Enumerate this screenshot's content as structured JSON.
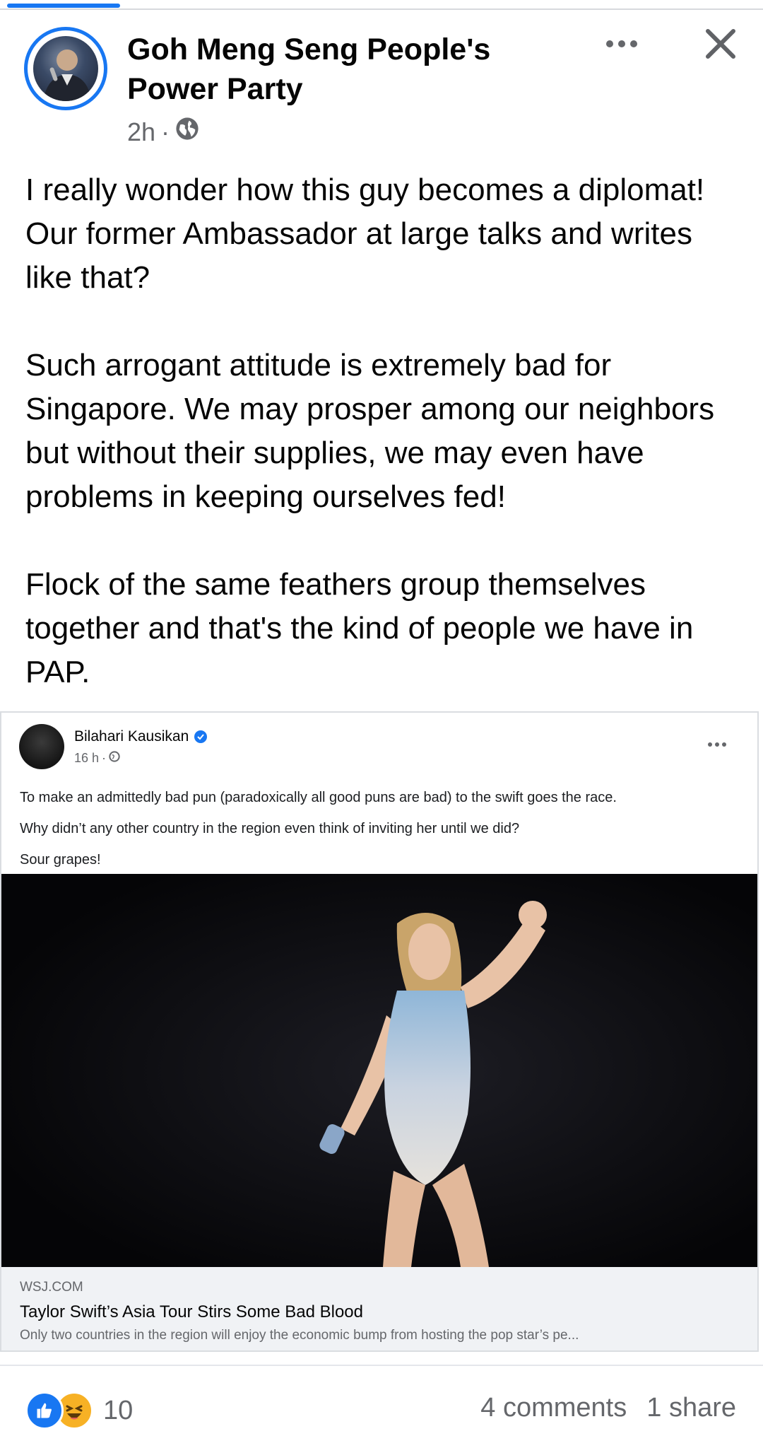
{
  "post": {
    "page_name": "Goh Meng Seng People's Power Party",
    "time": "2h",
    "separator": "·",
    "paragraphs": [
      "I really wonder how this guy becomes a diplomat! Our former Ambassador at large talks and writes like that?",
      "Such arrogant attitude is extremely bad for Singapore. We may prosper among our neighbors but without their supplies, we may even have problems in keeping ourselves fed!",
      "Flock of the same feathers group themselves together and that's the kind of people we have in PAP."
    ]
  },
  "shared_post": {
    "author": "Bilahari Kausikan",
    "time": "16 h",
    "separator": "·",
    "lines": [
      "To make an admittedly bad pun (paradoxically all good puns are bad) to the swift goes the race.",
      "Why didn’t any other country in the region even think of inviting her until we did?",
      "Sour grapes!"
    ],
    "link": {
      "domain": "WSJ.COM",
      "title": "Taylor Swift’s Asia Tour Stirs Some Bad Blood",
      "description": "Only two countries in the region will enjoy the economic bump from hosting the pop star’s pe..."
    }
  },
  "footer": {
    "reaction_count": "10",
    "comments": "4 comments",
    "shares": "1 share"
  },
  "icons": {
    "more": "more-horizontal-icon",
    "close": "close-icon",
    "globe": "globe-icon",
    "verified": "verified-badge-icon",
    "info": "info-icon",
    "like": "like-reaction-icon",
    "haha": "haha-reaction-icon"
  },
  "colors": {
    "accent": "#1877f2",
    "text": "#050505",
    "secondary": "#65676b",
    "link_bg": "#f0f2f5",
    "haha": "#f7b125"
  }
}
